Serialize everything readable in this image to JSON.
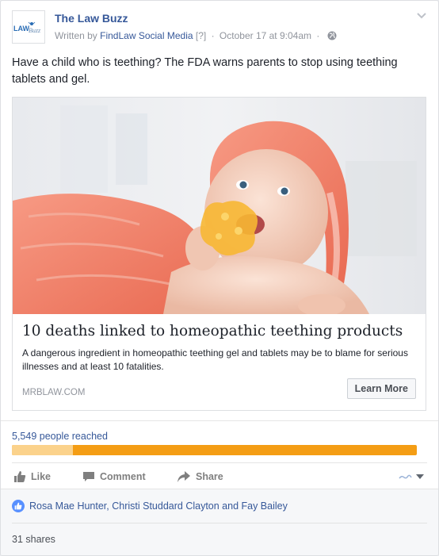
{
  "post": {
    "page_name": "The Law Buzz",
    "avatar_logo_text": "LAW Buzz",
    "written_by_prefix": "Written by",
    "author": "FindLaw Social Media",
    "author_help": "[?]",
    "separator": "·",
    "timestamp": "October 17 at 9:04am",
    "text": "Have a child who is teething? The FDA warns parents to stop using teething tablets and gel."
  },
  "link_preview": {
    "title": "10 deaths linked to homeopathic teething products",
    "description": "A dangerous ingredient in homeopathic teething gel and tablets may be to blame for serious illnesses and at least 10 fatalities.",
    "domain": "MRBLAW.COM",
    "button_label": "Learn More"
  },
  "insights": {
    "reached_label": "5,549 people reached",
    "organic_fraction": 0.15,
    "colors": {
      "organic": "#fbd28b",
      "paid": "#f49d14"
    }
  },
  "actions": {
    "like": "Like",
    "comment": "Comment",
    "share": "Share"
  },
  "reactions": {
    "likers": "Rosa Mae Hunter, Christi Studdard Clayton and Fay Bailey",
    "shares": "31 shares"
  },
  "icons": [
    "law-buzz-logo",
    "globe-icon",
    "chevron-down-icon",
    "like-icon",
    "comment-icon",
    "share-icon",
    "audience-dropdown-icon",
    "like-badge-icon"
  ],
  "colors": {
    "link": "#365899",
    "meta": "#90949c",
    "background": "#e9ebee"
  }
}
